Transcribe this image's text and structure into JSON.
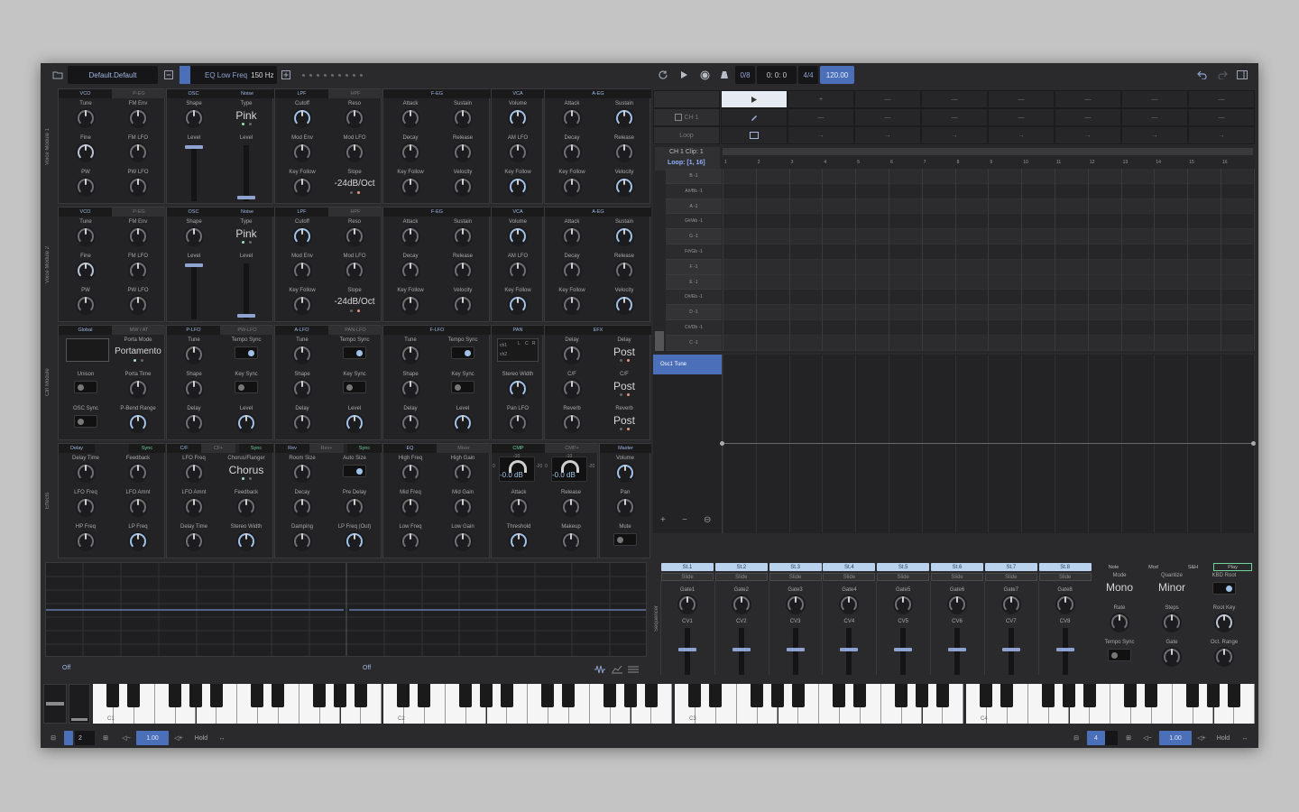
{
  "topbar": {
    "preset_name": "Default.Default",
    "param_name": "EQ Low Freq",
    "param_value": "150 Hz",
    "counter": "0/8",
    "position": "0: 0: 0",
    "time_sig": "4/4",
    "tempo": "120.00",
    "icons": [
      "folder-icon",
      "minus-box-icon",
      "plus-box-icon",
      "loop-icon",
      "play-icon",
      "record-icon",
      "metronome-icon",
      "undo-icon",
      "redo-icon",
      "sidebar-icon"
    ]
  },
  "rows": {
    "voice1": "Voice Module 1",
    "voice2": "Voice Module 2",
    "ctrl": "Ctrl Module",
    "effects": "Effects",
    "sequencer": "Sequencer"
  },
  "voice": {
    "tabs": [
      "VCO",
      "P-EG",
      "OSC",
      "Noise",
      "LPF",
      "HPF",
      "F-EG",
      "VCA",
      "A-EG"
    ],
    "vco": [
      "Tune",
      "FM Env",
      "Fine",
      "FM LFO",
      "PW",
      "PW LFO"
    ],
    "osc": [
      "Shape",
      "Level"
    ],
    "noise": [
      "Type",
      "Level"
    ],
    "noise_type": "Pink",
    "filter": [
      "Cutoff",
      "Reso",
      "Mod Env",
      "Mod LFO",
      "Key Follow",
      "Slope"
    ],
    "slope": "-24dB/Oct",
    "feg": [
      "Attack",
      "Sustain",
      "Decay",
      "Release",
      "Key Follow",
      "Velocity"
    ],
    "vca": [
      "Volume",
      "AM LFO",
      "Key Follow"
    ],
    "aeg": [
      "Attack",
      "Release",
      "Decay",
      "Release",
      "Key Follow",
      "Velocity"
    ],
    "aeg_top2": "Sustain"
  },
  "ctrl": {
    "tabs": [
      "Global",
      "MW / AT",
      "P-LFO",
      "PW-LFO",
      "A-LFO",
      "PAN-LFO",
      "F-LFO",
      "PAN",
      "EFX"
    ],
    "global": [
      "Porta Mode",
      "Unison",
      "Porta Time",
      "OSC Sync",
      "P-Bend Range"
    ],
    "porta_mode": "Portamento",
    "lfo": [
      "Tune",
      "Tempo Sync",
      "Shape",
      "Key Sync",
      "Delay",
      "Level"
    ],
    "pan": [
      "Stereo Width",
      "Pan LFO"
    ],
    "pan_labels": [
      "ch1",
      "ch2",
      "L",
      "C",
      "R"
    ],
    "efx": [
      "Delay",
      "Delay",
      "C/F",
      "C/F",
      "Reverb",
      "Reverb"
    ],
    "efx_value": "Post"
  },
  "effects": {
    "tabs": [
      "Delay",
      "Sync",
      "C/F",
      "CF+",
      "Sync",
      "Rev",
      "Rev+",
      "Sync",
      "EQ",
      "Mixer",
      "CMP",
      "CMP+",
      "Master"
    ],
    "delay": [
      "Delay Time",
      "Feedback",
      "LFO Freq",
      "LFO Amnt",
      "HP Freq",
      "LP Freq"
    ],
    "cf": [
      "LFO Freq",
      "Chorus/Flanger",
      "LFO Amnt",
      "Feedback",
      "Delay Time",
      "Stereo Width"
    ],
    "cf_value": "Chorus",
    "rev": [
      "Room Size",
      "Auto Size",
      "Decay",
      "Pre Delay",
      "Damping",
      "LP Freq (Out)"
    ],
    "eq": [
      "High Freq",
      "High Gain",
      "Mid Freq",
      "Mid Gain",
      "Low Freq",
      "Low Gain"
    ],
    "cmp": [
      "Attack",
      "Release",
      "Threshold",
      "Makeup"
    ],
    "cmp_db": "-0.0 dB",
    "cmp_scale": [
      "-10",
      "0",
      "-20"
    ],
    "master": [
      "Volume",
      "Pan",
      "Mute"
    ]
  },
  "scope": {
    "left_status": "Off",
    "right_status": "Off"
  },
  "launcher": {
    "ch_label": "CH 1",
    "loop_label": "Loop",
    "dash": "—",
    "plus": "+",
    "arrow": "→"
  },
  "pianoroll": {
    "clip_title": "CH 1 Clip: 1",
    "loop": "Loop: [1, 16]",
    "notes": [
      "B -1",
      "A#/Bb -1",
      "A -1",
      "G#/Ab -1",
      "G -1",
      "F#/Gb -1",
      "F -1",
      "E -1",
      "D#/Eb -1",
      "D -1",
      "C#/Db -1",
      "C -1"
    ],
    "bars": [
      "1",
      "2",
      "3",
      "4",
      "5",
      "6",
      "7",
      "8",
      "9",
      "10",
      "11",
      "12",
      "13",
      "14",
      "15",
      "16"
    ]
  },
  "automation": {
    "lane": "Osc1 Tune",
    "buttons": [
      "+",
      "−",
      "⊖"
    ]
  },
  "sequencer": {
    "steps": [
      "St.1",
      "St.2",
      "St.3",
      "St.4",
      "St.5",
      "St.6",
      "St.7",
      "St.8"
    ],
    "slide": "Slide",
    "gates": [
      "Gate1",
      "Gate2",
      "Gate3",
      "Gate4",
      "Gate5",
      "Gate6",
      "Gate7",
      "Gate8"
    ],
    "cvs": [
      "CV1",
      "CV2",
      "CV3",
      "CV4",
      "CV5",
      "CV6",
      "CV7",
      "CV8"
    ],
    "tabs": [
      "Note",
      "Mod",
      "S&H",
      "Play"
    ],
    "controls": [
      "Mode",
      "Quantize",
      "KBD Root",
      "Rate",
      "Steps",
      "Root Key",
      "Tempo Sync",
      "Gate",
      "Oct. Range"
    ],
    "mode": "Mono",
    "quantize": "Minor"
  },
  "keyboard": {
    "octaves": [
      "C1",
      "C2",
      "C3",
      "C4"
    ]
  },
  "bottombar": {
    "left_oct": "2",
    "left_vel": "1.00",
    "hold": "Hold",
    "right_oct": "4",
    "right_vel": "1.00",
    "hold2": "Hold"
  }
}
